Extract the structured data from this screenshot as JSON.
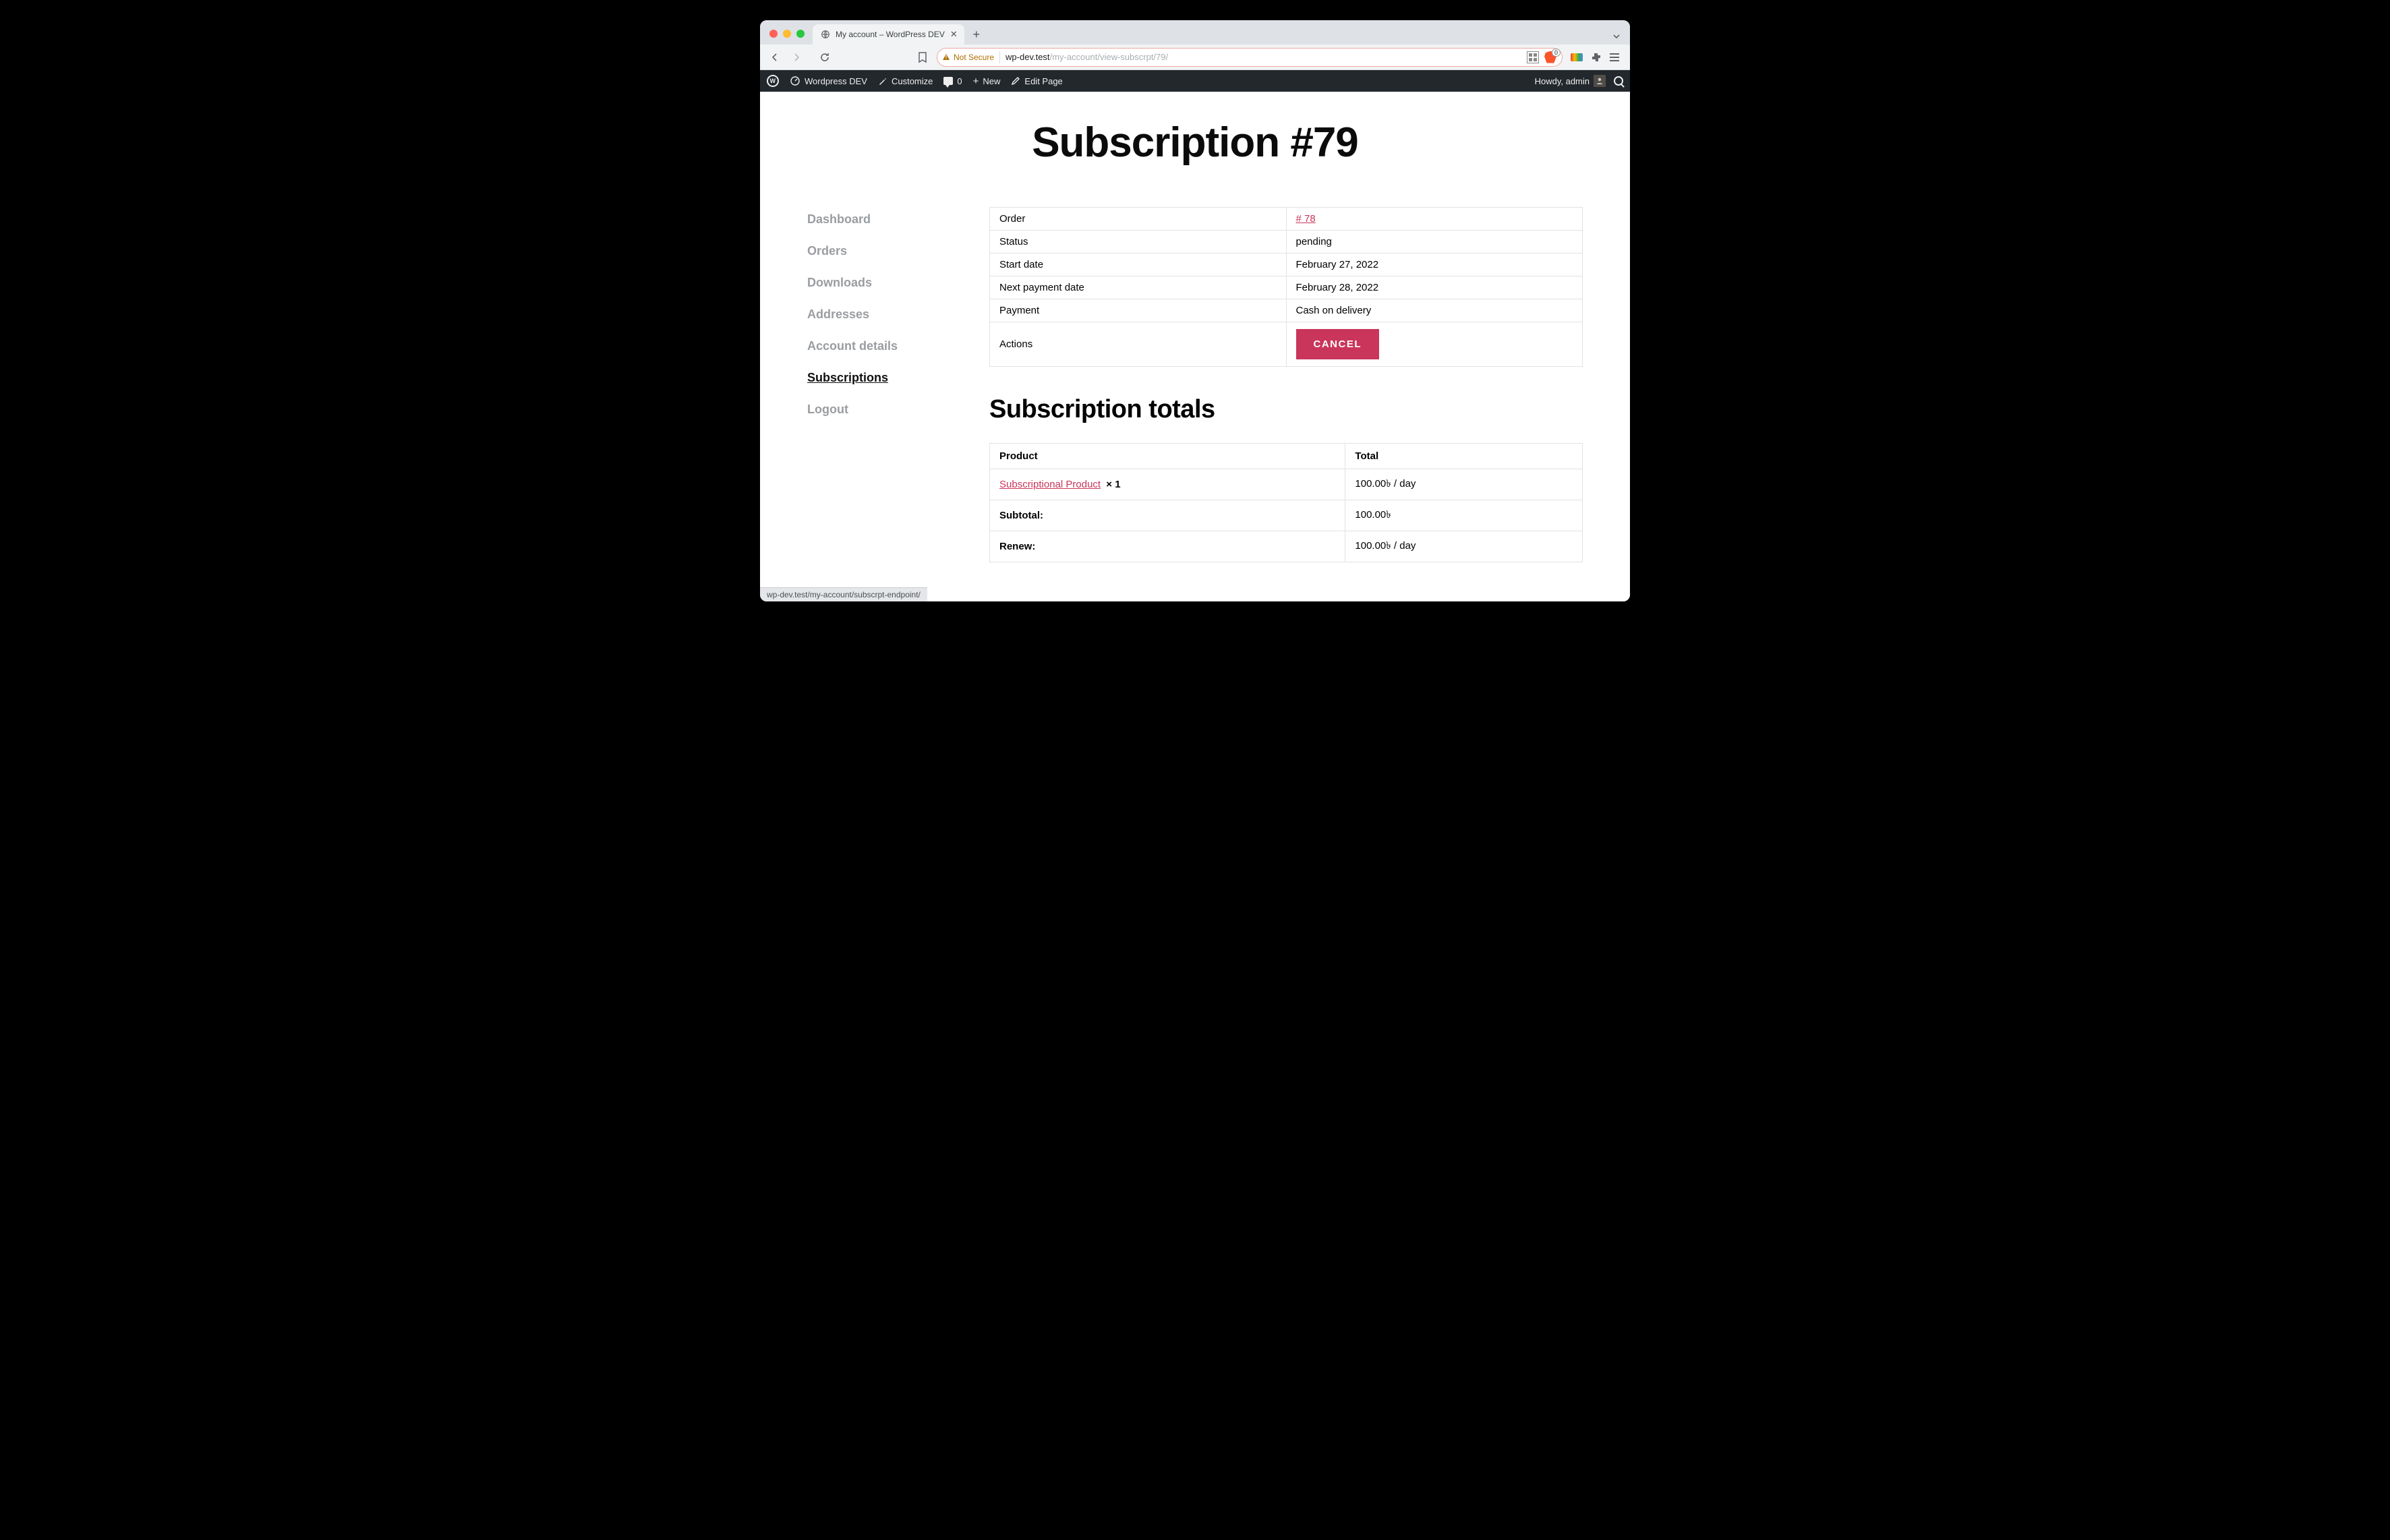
{
  "browser": {
    "tab_title": "My account – WordPress DEV",
    "not_secure_label": "Not Secure",
    "url_host": "wp-dev.test",
    "url_path": "/my-account/view-subscrpt/79/",
    "brave_count": "0"
  },
  "wpbar": {
    "site_name": "Wordpress DEV",
    "customize": "Customize",
    "comments_count": "0",
    "add_new": "New",
    "edit_page": "Edit Page",
    "howdy": "Howdy, admin"
  },
  "page": {
    "title": "Subscription #79",
    "section_title": "Subscription totals"
  },
  "sidebar": {
    "items": [
      {
        "label": "Dashboard",
        "active": false
      },
      {
        "label": "Orders",
        "active": false
      },
      {
        "label": "Downloads",
        "active": false
      },
      {
        "label": "Addresses",
        "active": false
      },
      {
        "label": "Account details",
        "active": false
      },
      {
        "label": "Subscriptions",
        "active": true
      },
      {
        "label": "Logout",
        "active": false
      }
    ]
  },
  "details": {
    "rows": [
      {
        "label": "Order",
        "value": "# 78",
        "link": true
      },
      {
        "label": "Status",
        "value": "pending"
      },
      {
        "label": "Start date",
        "value": "February 27, 2022"
      },
      {
        "label": "Next payment date",
        "value": "February 28, 2022"
      },
      {
        "label": "Payment",
        "value": "Cash on delivery"
      }
    ],
    "actions_label": "Actions",
    "cancel_button": "CANCEL"
  },
  "totals": {
    "head_product": "Product",
    "head_total": "Total",
    "product_name": "Subscriptional Product",
    "product_qty": "× 1",
    "product_total": "100.00৳  / day",
    "subtotal_label": "Subtotal:",
    "subtotal_value": "100.00৳",
    "renew_label": "Renew:",
    "renew_value": "100.00৳  / day"
  },
  "statusbar": {
    "text": "wp-dev.test/my-account/subscrpt-endpoint/"
  }
}
